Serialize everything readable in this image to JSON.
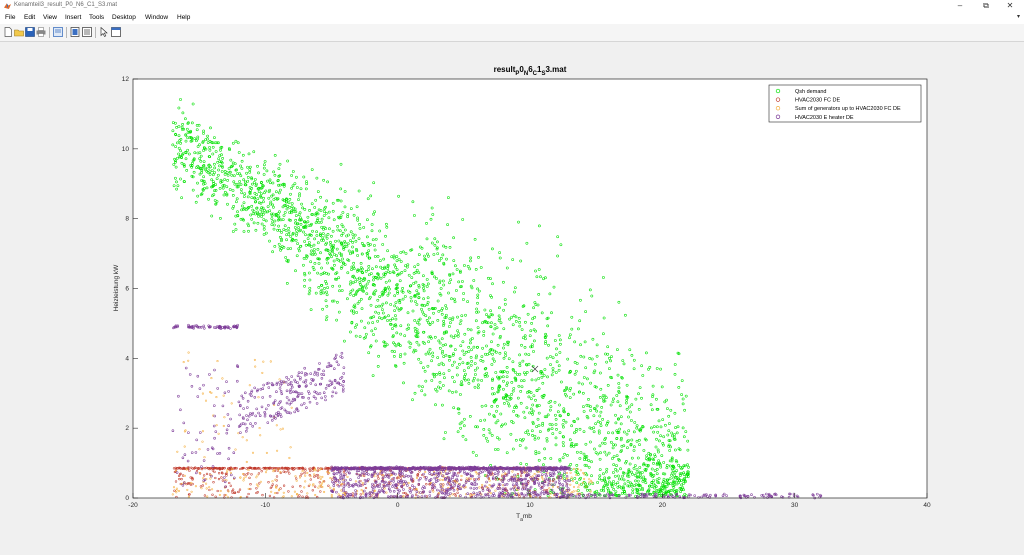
{
  "window": {
    "title": "Kenamteil3_result_P0_N6_C1_S3.mat",
    "minimize_glyph": "–",
    "maximize_glyph": "⧉",
    "accent": "#d9534f"
  },
  "menu": {
    "items": [
      "File",
      "Edit",
      "View",
      "Insert",
      "Tools",
      "Desktop",
      "Window",
      "Help"
    ]
  },
  "toolbar": {
    "icons": [
      "new-figure-icon",
      "open-file-icon",
      "save-icon",
      "print-icon",
      "print-preview-icon",
      "link-plot-icon",
      "insert-legend-icon",
      "edit-plot-icon",
      "dock-icon"
    ]
  },
  "chart_data": {
    "type": "scatter",
    "title_base": "result",
    "title_parts": [
      {
        "text": "result",
        "sub": false
      },
      {
        "text": "P",
        "sub": true
      },
      {
        "text": "0",
        "sub": false
      },
      {
        "text": "N",
        "sub": true
      },
      {
        "text": "6",
        "sub": false
      },
      {
        "text": "C",
        "sub": true
      },
      {
        "text": "1",
        "sub": false
      },
      {
        "text": "S",
        "sub": true
      },
      {
        "text": "3.mat",
        "sub": false
      }
    ],
    "xlabel_main": "T",
    "xlabel_sub": "a",
    "xlabel_rest": "mb",
    "ylabel": "Heizleistung kW",
    "xlim": [
      -20,
      40
    ],
    "ylim": [
      0,
      12
    ],
    "xticks": [
      -20,
      -10,
      0,
      10,
      20,
      30,
      40
    ],
    "yticks": [
      0,
      2,
      4,
      6,
      8,
      10,
      12
    ],
    "grid": false,
    "legend_position": "top-right",
    "series": [
      {
        "name": "Qsh demand",
        "color": "#00e000",
        "trend": {
          "x_start": -17,
          "y_start": 10.2,
          "x_end": 21,
          "y_end": 0.3
        },
        "x_range": [
          -17,
          22
        ],
        "count": 2600
      },
      {
        "name": "HVAC2030 FC DE",
        "color": "#c0392b",
        "plateau_y": 0.85,
        "x_range": [
          -17,
          12
        ],
        "count": 700
      },
      {
        "name": "Sum of generators up to HVAC2030 FC DE",
        "color": "#f5b041",
        "plateau_y": 0.85,
        "x_range": [
          -17,
          15
        ],
        "count": 400
      },
      {
        "name": "HVAC2030 E heater DE",
        "color": "#7d3c98",
        "plateau_y": 0.85,
        "x_range": [
          -17,
          32
        ],
        "count": 1700
      }
    ]
  }
}
